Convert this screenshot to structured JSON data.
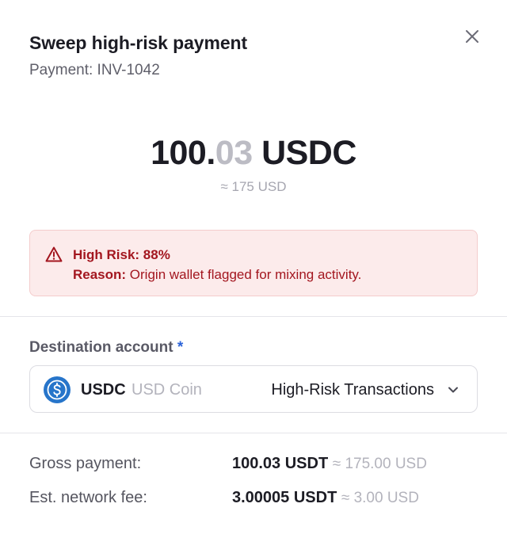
{
  "dialog": {
    "title": "Sweep high-risk payment",
    "subtitle": "Payment: INV-1042",
    "close_icon": "close-icon"
  },
  "amount": {
    "integer": "100.",
    "decimals": "03",
    "currency": " USDC",
    "usd_equivalent": "≈ 175 USD"
  },
  "risk": {
    "icon": "warning-triangle-icon",
    "label": "High Risk: 88%",
    "reason_label": "Reason:",
    "reason_text": " Origin wallet flagged for mixing activity.",
    "color": "#a3161f",
    "background": "#fcebeb"
  },
  "destination": {
    "label": "Destination account",
    "required_marker": " *",
    "coin_icon": "usdc-coin-icon",
    "coin_symbol": "USDC",
    "coin_name": "USD Coin",
    "account": "High-Risk Transactions",
    "chevron_icon": "chevron-down-icon"
  },
  "summary": [
    {
      "label": "Gross payment:",
      "value": "100.03 USDT",
      "approx": "≈ 175.00 USD"
    },
    {
      "label": "Est. network fee:",
      "value": "3.00005 USDT",
      "approx": "≈ 3.00 USD"
    }
  ],
  "colors": {
    "accent": "#2a62d8",
    "coin": "#2775ca",
    "danger": "#a3161f"
  }
}
